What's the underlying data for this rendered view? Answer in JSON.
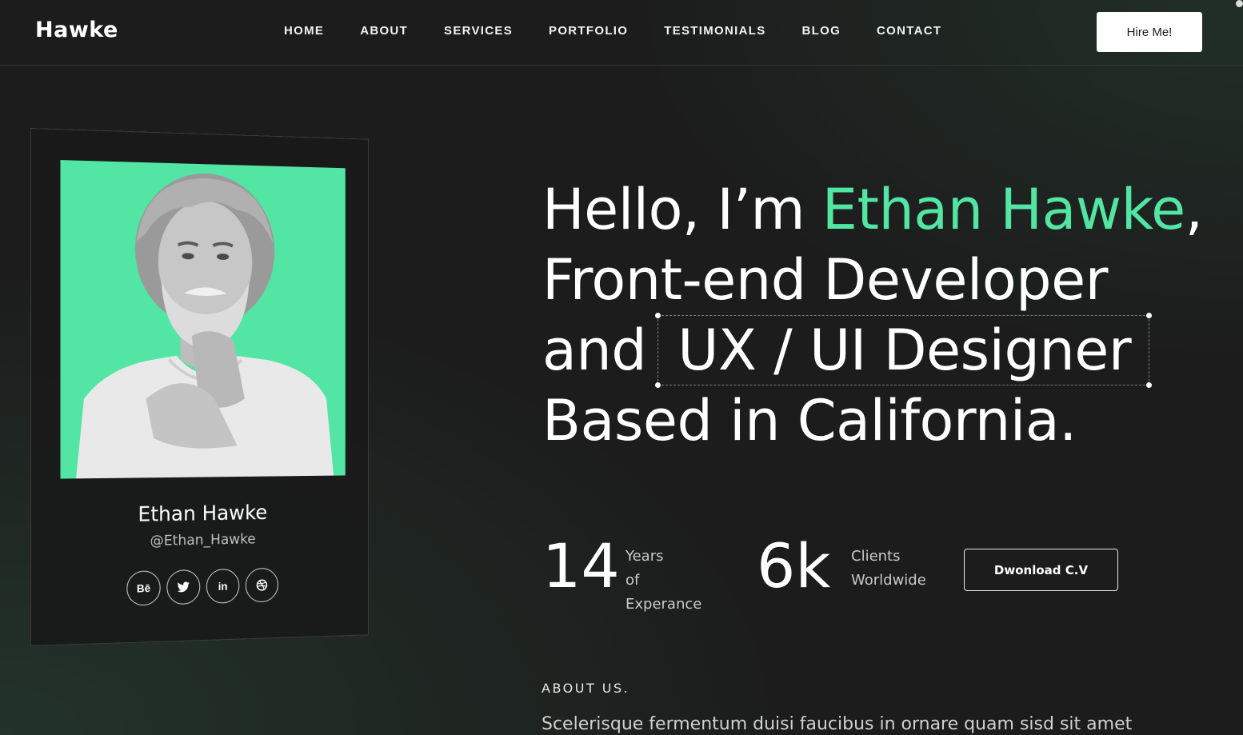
{
  "header": {
    "logo": "Hawke",
    "nav": [
      "HOME",
      "ABOUT",
      "SERVICES",
      "PORTFOLIO",
      "TESTIMONIALS",
      "BLOG",
      "CONTACT"
    ],
    "cta_label": "Hire Me!"
  },
  "profile": {
    "name": "Ethan Hawke",
    "handle": "@Ethan_Hawke",
    "photo_bg_color": "#52e5a4",
    "socials": [
      {
        "label": "Bē",
        "icon": "behance-icon"
      },
      {
        "label": "🐦",
        "icon": "twitter-icon"
      },
      {
        "label": "in",
        "icon": "linkedin-icon"
      },
      {
        "label": "◎",
        "icon": "dribbble-icon"
      }
    ]
  },
  "hero": {
    "greeting": "Hello, I’m ",
    "name": "Ethan Hawke",
    "comma": ",",
    "line2": "Front-end Developer",
    "line3_prefix": "and",
    "line3_boxed": "UX / UI Designer",
    "line4": "Based in California."
  },
  "stats": [
    {
      "value": "14",
      "label_line1": "Years",
      "label_line2": "of Experance"
    },
    {
      "value": "6k",
      "label_line1": "Clients",
      "label_line2": "Worldwide"
    }
  ],
  "download_cv_label": "Dwonload C.V",
  "about": {
    "heading": "ABOUT US.",
    "text": "Scelerisque fermentum duisi faucibus in ornare quam sisd sit amet"
  },
  "colors": {
    "accent": "#52e5a4",
    "background": "#1c1c1c",
    "text": "#ffffff"
  }
}
